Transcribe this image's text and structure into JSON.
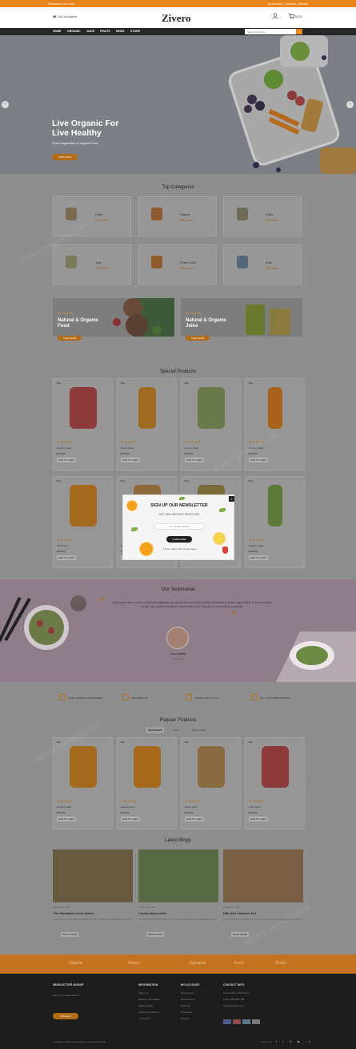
{
  "topbar": {
    "left": "Welcome to our shop",
    "right": "My Account  |  Checkout  |  Wishlist"
  },
  "header": {
    "logo": "Zivero",
    "callus": "Call Us Anytime",
    "cart": "$0.00",
    "search_placeholder": "Search Products"
  },
  "nav": [
    "HOME",
    "ORGANIC",
    "JUICE",
    "FRUITS",
    "NEWS",
    "STORE"
  ],
  "hero": {
    "title_line1": "Live Organic For",
    "title_line2": "Live Healthy",
    "subtitle": "Fresh Vegetables & Organic Food",
    "button": "SHOP NOW"
  },
  "categories": {
    "title": "Top Categories",
    "items": [
      {
        "name": "Fruits",
        "count": "(10) Items"
      },
      {
        "name": "Organic",
        "count": "(05) Items"
      },
      {
        "name": "Drinks",
        "count": "(10) Items"
      },
      {
        "name": "Juice",
        "count": "(05) Items"
      },
      {
        "name": "Protein Juice",
        "count": "(05) Items"
      },
      {
        "name": "Drink",
        "count": "(10) Items"
      }
    ]
  },
  "banners": [
    {
      "tag": "Sale Upto 40%",
      "title": "Natural & Organic Food",
      "button": "SHOP NOW"
    },
    {
      "tag": "Sale Upto 40%",
      "title": "Natural & Organic Juice",
      "button": "SHOP NOW"
    }
  ],
  "special": {
    "title": "Special Products",
    "products": [
      {
        "badge": "Sale",
        "name": "Organic Juice",
        "price": "$120.00",
        "add": "ADD TO CART"
      },
      {
        "badge": "Sale",
        "name": "Mixed Juice",
        "price": "$140.00",
        "add": "ADD TO CART"
      },
      {
        "badge": "Sale",
        "name": "Lemon Juice",
        "price": "$160.00",
        "add": "ADD TO CART"
      },
      {
        "badge": "Sale",
        "name": "Orange Juice",
        "price": "$130.00",
        "add": "ADD TO CART"
      },
      {
        "badge": "Sale",
        "name": "Fruit Puree",
        "price": "$120.00",
        "add": "ADD TO CART"
      },
      {
        "badge": "Sale",
        "name": "Natural Juice",
        "price": "$110.00",
        "add": "ADD TO CART"
      },
      {
        "badge": "Sale",
        "name": "Veggie Drink",
        "price": "$150.00",
        "add": "ADD TO CART"
      },
      {
        "badge": "Sale",
        "name": "Organic Apple",
        "price": "$125.00",
        "add": "ADD TO CART"
      }
    ]
  },
  "popup": {
    "title": "SIGN UP OUR NEWSLETTER",
    "subtitle": "GET 20% INSTANT DISCOUNT",
    "input_placeholder": "Your Email Address",
    "button": "SUBSCRIBE",
    "dismiss": "Don't Show This Popup Again"
  },
  "testimonial": {
    "title": "Our Testimonial",
    "quote": "Lorem ipsum dolor sit amet, consectetur adipiscing elit, sed do eiusmod tempor incididunt ut labore et dolore magna aliqua. Ut enim ad minim veniam, quis nostrud exercitation ullamco laboris nisi ut aliquip ex ea commodo consequat.",
    "name": "Lisa Charles",
    "role": "Customer"
  },
  "features": [
    "FREE SHIPPING WORLDWIDE",
    "100% REFUND",
    "SPECIAL GIFT CARD",
    "24/7 CUSTOMER SERVICE"
  ],
  "popular": {
    "title": "Popular Products",
    "tabs": [
      "Best Sellers",
      "Latest",
      "New Arrivals"
    ],
    "products": [
      {
        "badge": "Sale",
        "name": "Organic Juice",
        "price": "$120.00",
        "add": "ADD TO CART"
      },
      {
        "badge": "Sale",
        "name": "Natural Juice",
        "price": "$140.00",
        "add": "ADD TO CART"
      },
      {
        "badge": "Sale",
        "name": "Mixed Fruit",
        "price": "$160.00",
        "add": "ADD TO CART"
      },
      {
        "badge": "Sale",
        "name": "Fruit Punch",
        "price": "$130.00",
        "add": "ADD TO CART"
      }
    ]
  },
  "blogs": {
    "title": "Latest Blogs",
    "items": [
      {
        "meta": "August 10, 2021",
        "title": "The Standard Lorem Ipsum",
        "text": "Lorem ipsum is simply dummy text of the printing and typesetting industry.",
        "more": "READ MORE"
      },
      {
        "meta": "August 10, 2021",
        "title": "Lorem Ipsum Dolo",
        "text": "Lorem ipsum is simply dummy text of the printing and typesetting industry.",
        "more": "READ MORE"
      },
      {
        "meta": "August 10, 2021",
        "title": "Ham Nel Vivamus Est",
        "text": "Lorem ipsum is simply dummy text of the printing and typesetting industry.",
        "more": "READ MORE"
      }
    ]
  },
  "brands": [
    "Organic",
    "Nature",
    "Signature",
    "Fresh",
    "Brand"
  ],
  "footer": {
    "cols": [
      {
        "title": "NEWSLETTER SIGNUP",
        "links": [
          "Enter your email address",
          "Subscribe"
        ]
      },
      {
        "title": "INFORMATION",
        "links": [
          "About Us",
          "Delivery Information",
          "Privacy Policy",
          "Terms & Conditions",
          "Contact Us"
        ]
      },
      {
        "title": "MY ACCOUNT",
        "links": [
          "My Account",
          "Order History",
          "Wish List",
          "Newsletter",
          "Returns"
        ]
      },
      {
        "title": "CONTACT INFO",
        "links": [
          "Demo Store, 1234 Street",
          "(+91) 0123 456 789",
          "info@example.com"
        ]
      }
    ],
    "copyright": "Copyright © 2021 Zivero Store. All rights reserved.",
    "follow": "Follow Us"
  },
  "watermark": "WWW.DOWNHOSE.COM"
}
